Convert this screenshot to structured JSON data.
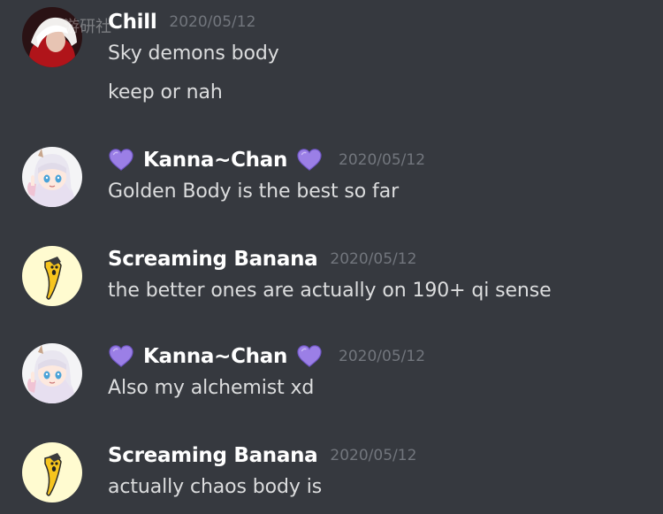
{
  "watermark": "游研社",
  "messages": [
    {
      "username": "Chill",
      "timestamp": "2020/05/12",
      "lines": [
        "Sky demons body",
        "keep or nah"
      ],
      "avatar": "red-character-avatar",
      "hearts": false
    },
    {
      "username": "Kanna~Chan",
      "timestamp": "2020/05/12",
      "lines": [
        "Golden Body is the best so far"
      ],
      "avatar": "kanna-anime-avatar",
      "hearts": true,
      "heart_color": "#9b7fe6"
    },
    {
      "username": "Screaming Banana",
      "timestamp": "2020/05/12",
      "lines": [
        "the better ones are actually on 190+ qi sense"
      ],
      "avatar": "banana-avatar",
      "hearts": false
    },
    {
      "username": "Kanna~Chan",
      "timestamp": "2020/05/12",
      "lines": [
        "Also my alchemist xd"
      ],
      "avatar": "kanna-anime-avatar",
      "hearts": true,
      "heart_color": "#9b7fe6"
    },
    {
      "username": "Screaming Banana",
      "timestamp": "2020/05/12",
      "lines": [
        "actually chaos body is"
      ],
      "avatar": "banana-avatar",
      "hearts": false
    }
  ],
  "colors": {
    "background": "#36393f",
    "username": "#ffffff",
    "text": "#dcddde",
    "timestamp": "#72767d"
  }
}
